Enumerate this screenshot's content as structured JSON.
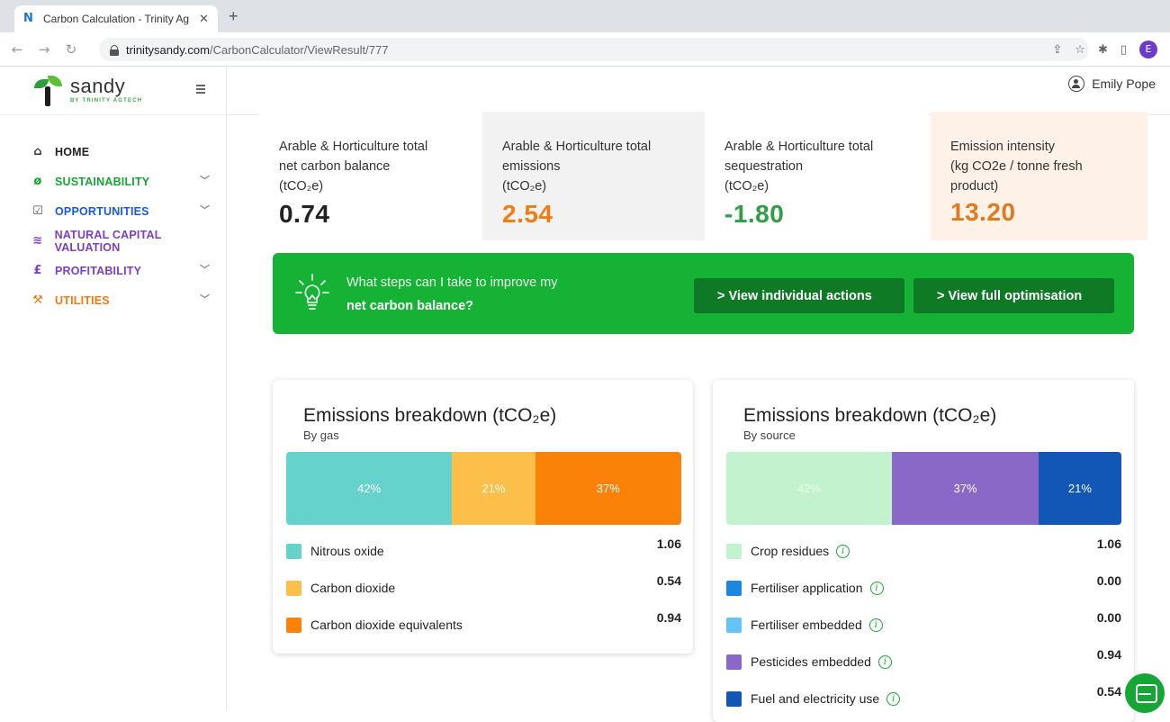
{
  "browser": {
    "tab_title": "Carbon Calculation - Trinity Ag",
    "tab_close": "✕",
    "new_tab": "+",
    "url_host": "trinitysandy.com",
    "url_path": "/CarbonCalculator/ViewResult/777",
    "profile_initial": "E"
  },
  "brand": {
    "name": "sandy",
    "tagline": "BY TRINITY AGTECH"
  },
  "user": {
    "name": "Emily Pope"
  },
  "nav": [
    {
      "label": "HOME",
      "color": "#222222",
      "icon": "home-icon"
    },
    {
      "label": "SUSTAINABILITY",
      "color": "#16a636",
      "icon": "leaf-icon",
      "chevron": true
    },
    {
      "label": "OPPORTUNITIES",
      "color": "#1a5bd6",
      "icon": "checklist-icon",
      "chevron": true
    },
    {
      "label": "NATURAL CAPITAL VALUATION",
      "color": "#7b3fc4",
      "icon": "landscape-icon"
    },
    {
      "label": "PROFITABILITY",
      "color": "#7b3fc4",
      "icon": "pound-icon",
      "chevron": true
    },
    {
      "label": "UTILITIES",
      "color": "#f07a12",
      "icon": "wrench-icon",
      "chevron": true
    }
  ],
  "stats": [
    {
      "label_1": "Arable & Horticulture total",
      "label_2": "net carbon balance",
      "label_3": "(tCO₂e)",
      "value": "0.74",
      "color": "#222222"
    },
    {
      "label_1": "Arable & Horticulture total",
      "label_2": "emissions",
      "label_3": "(tCO₂e)",
      "value": "2.54",
      "color": "#ef7d14"
    },
    {
      "label_1": "Arable & Horticulture total",
      "label_2": "sequestration",
      "label_3": "(tCO₂e)",
      "value": "-1.80",
      "color": "#2f9e44"
    },
    {
      "label_1": "Emission intensity",
      "label_2": "(kg CO2e / tonne fresh",
      "label_3": "product)",
      "value": "13.20",
      "color": "#e07a1f"
    }
  ],
  "banner": {
    "question_1": "What steps can I take to improve my",
    "question_2": "net carbon balance?",
    "btn_individual": "> View individual actions",
    "btn_full": "> View full optimisation"
  },
  "gas_card": {
    "title": "Emissions breakdown (tCO₂e)",
    "subtitle": "By gas",
    "segments": [
      {
        "percent": 42,
        "label": "42%",
        "color": "#66d2cc"
      },
      {
        "percent": 21,
        "label": "21%",
        "color": "#fbbf4a"
      },
      {
        "percent": 37,
        "label": "37%",
        "color": "#fb8209"
      }
    ],
    "legend": [
      {
        "name": "Nitrous oxide",
        "value": "1.06",
        "color": "#66d2cc"
      },
      {
        "name": "Carbon dioxide",
        "value": "0.54",
        "color": "#fbbf4a"
      },
      {
        "name": "Carbon dioxide equivalents",
        "value": "0.94",
        "color": "#fb8209"
      }
    ]
  },
  "source_card": {
    "title": "Emissions breakdown (tCO₂e)",
    "subtitle": "By source",
    "segments": [
      {
        "percent": 42,
        "label": "42%",
        "color": "#c3f2cf"
      },
      {
        "percent": 37,
        "label": "37%",
        "color": "#8a68c7"
      },
      {
        "percent": 21,
        "label": "21%",
        "color": "#1257b5"
      }
    ],
    "legend": [
      {
        "name": "Crop residues",
        "value": "1.06",
        "color": "#c3f2cf"
      },
      {
        "name": "Fertiliser application",
        "value": "0.00",
        "color": "#1f86e0"
      },
      {
        "name": "Fertiliser embedded",
        "value": "0.00",
        "color": "#65c4f6"
      },
      {
        "name": "Pesticides embedded",
        "value": "0.94",
        "color": "#8a68c7"
      },
      {
        "name": "Fuel and electricity use",
        "value": "0.54",
        "color": "#1257b5"
      }
    ]
  },
  "info_glyph": "i"
}
